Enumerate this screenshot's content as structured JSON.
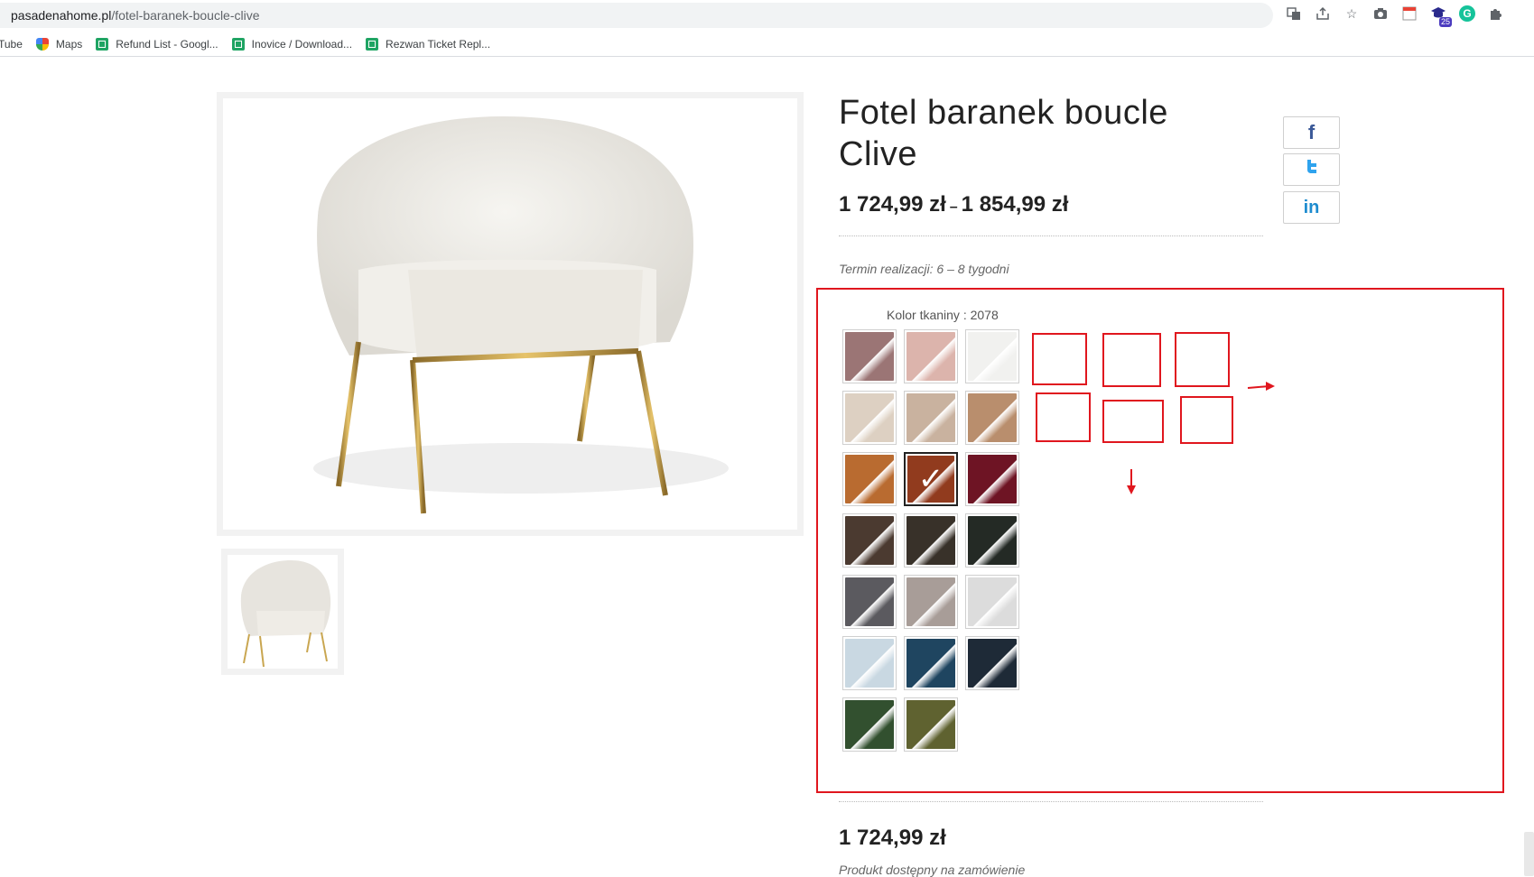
{
  "browser": {
    "url_domain": "pasadenahome.pl",
    "url_path": "/fotel-baranek-boucle-clive",
    "bookmarks": [
      {
        "label": "Tube",
        "icon": "none"
      },
      {
        "label": "Maps",
        "icon": "maps-icon"
      },
      {
        "label": "Refund List - Googl...",
        "icon": "sheets-icon"
      },
      {
        "label": "Inovice / Download...",
        "icon": "sheets-icon"
      },
      {
        "label": "Rezwan Ticket Repl...",
        "icon": "sheets-icon"
      }
    ],
    "extension_badge": "25"
  },
  "product": {
    "title": "Fotel baranek boucle Clive",
    "price_min": "1 724,99 zł",
    "price_separator": "–",
    "price_max": "1 854,99 zł",
    "lead_time": "Termin realizacji: 6 – 8 tygodni",
    "current_price": "1 724,99 zł",
    "availability": "Produkt dostępny na zamówienie"
  },
  "color_picker": {
    "label": "Kolor tkaniny : 2078",
    "selected_index": 7,
    "swatches": [
      {
        "color": "#9b7575"
      },
      {
        "color": "#dcb4ac"
      },
      {
        "color": "#f1f1ef"
      },
      {
        "color": "#ddd0c2"
      },
      {
        "color": "#c9b29f"
      },
      {
        "color": "#b98e6d"
      },
      {
        "color": "#b96b30"
      },
      {
        "color": "#913b1e"
      },
      {
        "color": "#6e1424"
      },
      {
        "color": "#4b3a30"
      },
      {
        "color": "#383129"
      },
      {
        "color": "#242a25"
      },
      {
        "color": "#5b5a5f"
      },
      {
        "color": "#a89d98"
      },
      {
        "color": "#dcdcdc"
      },
      {
        "color": "#c9d8e2"
      },
      {
        "color": "#1f4560"
      },
      {
        "color": "#1e2a37"
      },
      {
        "color": "#32502f"
      },
      {
        "color": "#5f6230"
      }
    ]
  },
  "colors": {
    "annotation_red": "#e0161e",
    "facebook": "#3b5998",
    "twitter": "#2fa3ee",
    "linkedin": "#1e8ccf"
  }
}
